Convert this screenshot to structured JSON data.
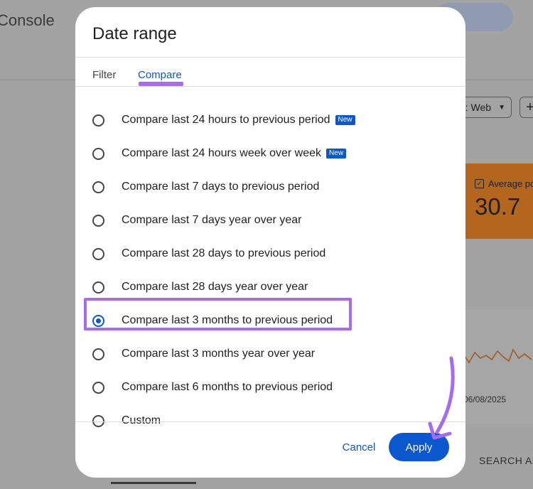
{
  "background": {
    "brand": "Console",
    "device_filter": ": Web",
    "add_button": "+",
    "card_label": "Average po",
    "card_value": "30.7",
    "chart_date": "06/08/2025",
    "search_appearance": "SEARCH APP"
  },
  "dialog": {
    "title": "Date range",
    "tabs": [
      {
        "label": "Filter",
        "active": false
      },
      {
        "label": "Compare",
        "active": true
      }
    ],
    "options": [
      {
        "label": "Compare last 24 hours to previous period",
        "badge": "New",
        "selected": false
      },
      {
        "label": "Compare last 24 hours week over week",
        "badge": "New",
        "selected": false
      },
      {
        "label": "Compare last 7 days to previous period",
        "selected": false
      },
      {
        "label": "Compare last 7 days year over year",
        "selected": false
      },
      {
        "label": "Compare last 28 days to previous period",
        "selected": false
      },
      {
        "label": "Compare last 28 days year over year",
        "selected": false
      },
      {
        "label": "Compare last 3 months to previous period",
        "selected": true
      },
      {
        "label": "Compare last 3 months year over year",
        "selected": false
      },
      {
        "label": "Compare last 6 months to previous period",
        "selected": false
      },
      {
        "label": "Custom",
        "selected": false
      }
    ],
    "cancel_label": "Cancel",
    "apply_label": "Apply"
  },
  "colors": {
    "accent_blue": "#0b57d0",
    "annotation_purple": "#a56cf0",
    "card_orange": "#b4661f"
  },
  "icons": {
    "filter_caret": "caret-down-icon",
    "add": "plus-icon",
    "card_checkbox": "checkbox-checked-icon",
    "annotation": "curved-arrow-icon"
  }
}
